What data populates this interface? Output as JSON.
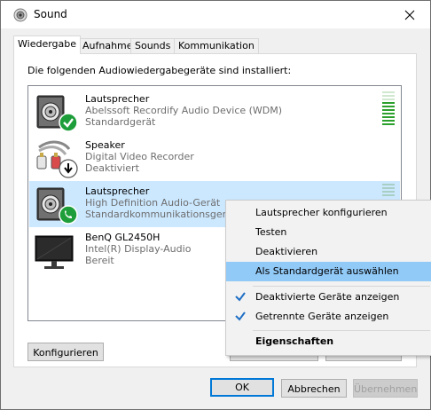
{
  "window": {
    "title": "Sound"
  },
  "tabs": [
    "Wiedergabe",
    "Aufnahme",
    "Sounds",
    "Kommunikation"
  ],
  "intro": "Die folgenden Audiowiedergabegeräte sind installiert:",
  "devices": [
    {
      "name": "Lautsprecher",
      "desc": "Abelssoft Recordify Audio Device (WDM)",
      "status": "Standardgerät",
      "icon": "speaker-icon",
      "badge": "default-check-icon"
    },
    {
      "name": "Speaker",
      "desc": "Digital Video Recorder",
      "status": "Deaktiviert",
      "icon": "rca-cable-icon",
      "badge": "disabled-arrow-icon"
    },
    {
      "name": "Lautsprecher",
      "desc": "High Definition Audio-Gerät",
      "status": "Standardkommunikationsgerät",
      "icon": "speaker-icon",
      "badge": "phone-icon"
    },
    {
      "name": "BenQ GL2450H",
      "desc": "Intel(R) Display-Audio",
      "status": "Bereit",
      "icon": "monitor-icon",
      "badge": ""
    }
  ],
  "buttons": {
    "configure": "Konfigurieren",
    "ok": "OK",
    "cancel": "Abbrechen",
    "apply": "Übernehmen"
  },
  "context_menu": {
    "items": [
      {
        "label": "Lautsprecher konfigurieren",
        "checked": false
      },
      {
        "label": "Testen",
        "checked": false
      },
      {
        "label": "Deaktivieren",
        "checked": false
      },
      {
        "label": "Als Standardgerät auswählen",
        "checked": false,
        "hover": true
      },
      {
        "label": "Deaktivierte Geräte anzeigen",
        "checked": true
      },
      {
        "label": "Getrennte Geräte anzeigen",
        "checked": true
      },
      {
        "label": "Eigenschaften",
        "checked": false,
        "bold": true
      }
    ]
  },
  "colors": {
    "accent": "#0078d7",
    "selection": "#cce8ff",
    "menu_hover": "#91c9f7",
    "meter_green": "#2ca02c",
    "status_green": "#1e9e3a"
  }
}
